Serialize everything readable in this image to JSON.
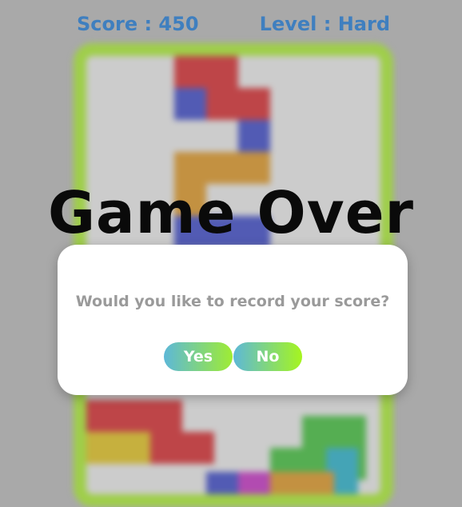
{
  "hud": {
    "score_text": "Score : 450",
    "level_text": "Level : Hard"
  },
  "overlay": {
    "title": "Game Over"
  },
  "dialog": {
    "message": "Would you like to record your score?",
    "yes_label": "Yes",
    "no_label": "No"
  },
  "colors": {
    "hud_text": "#3f7fbf",
    "board_border": "#9fce4a",
    "block_red": "#e8262a",
    "block_blue": "#3b49d9",
    "block_orange": "#f0a020",
    "block_yellow": "#f5d21a",
    "block_green": "#3fcf3a",
    "block_cyan": "#24bfdc",
    "block_magenta": "#d62fd3"
  }
}
